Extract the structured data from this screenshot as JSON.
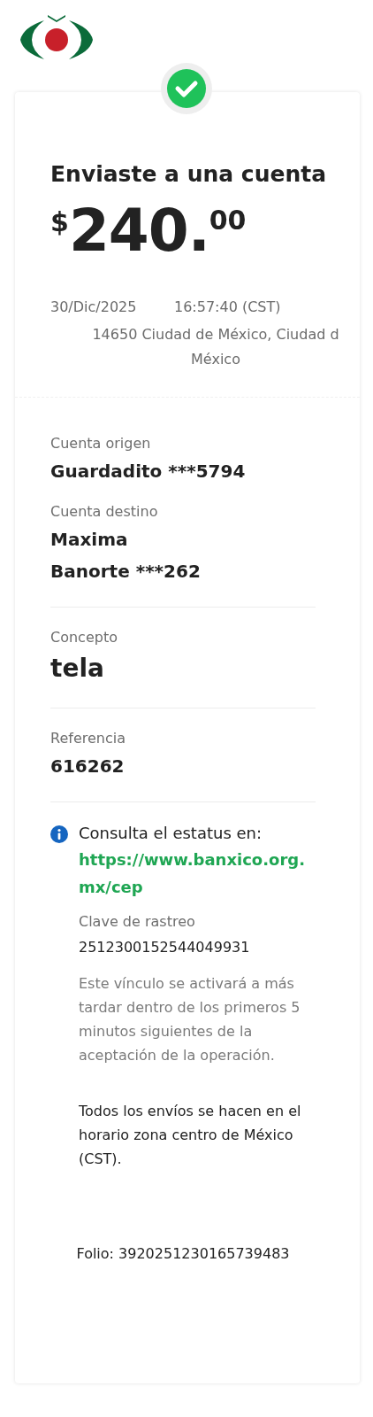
{
  "receipt": {
    "title": "Enviaste a una cuenta",
    "amount": {
      "currency": "$",
      "whole": "240.",
      "cents": "00"
    },
    "date": "30/Dic/2025",
    "time": "16:57:40 (CST)",
    "location_lines": [
      "14650 Ciudad de México, Ciudad d",
      "México"
    ]
  },
  "details": [
    {
      "label": "Cuenta origen",
      "value_lines": [
        "Guardadito ***5794"
      ],
      "kind": "normal",
      "divider_after": false
    },
    {
      "label": "Cuenta destino",
      "value_lines": [
        "Maxima",
        "Banorte ***262"
      ],
      "kind": "normal",
      "divider_after": true
    },
    {
      "label": "Concepto",
      "value_lines": [
        "tela"
      ],
      "kind": "large",
      "divider_after": true
    },
    {
      "label": "Referencia",
      "value_lines": [
        "616262"
      ],
      "kind": "normal",
      "divider_after": true
    }
  ],
  "status_info": {
    "heading": "Consulta el estatus en:",
    "link": "https://www.banxico.org.mx/cep",
    "tracking_label": "Clave de rastreo",
    "tracking_key": "2512300152544049931",
    "note": "Este vínculo se activará a más tardar dentro de los primeros 5 minutos siguientes de la aceptación de la operación."
  },
  "timezone_note": "Todos los envíos se hacen en el horario zona centro de México (CST).",
  "folio": "Folio: 3920251230165739483"
}
